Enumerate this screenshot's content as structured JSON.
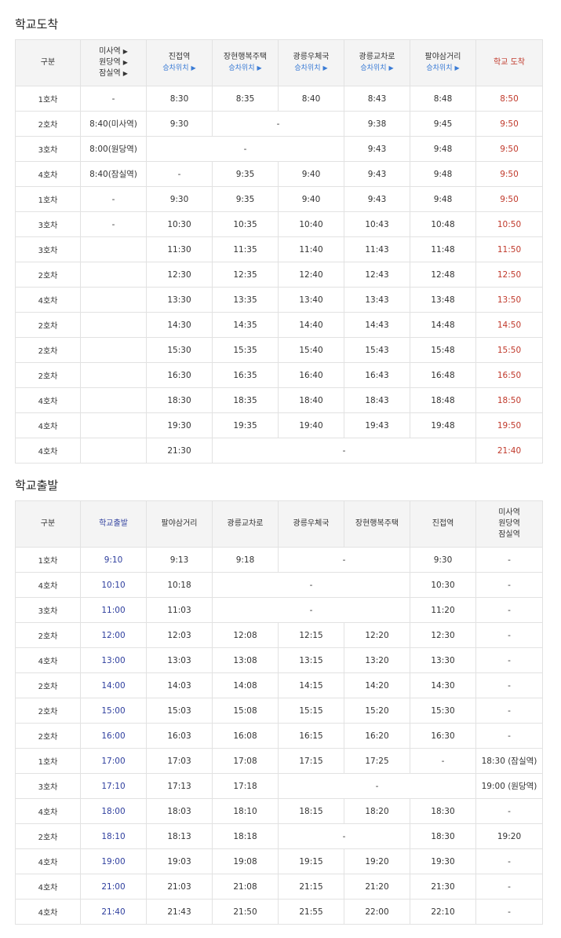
{
  "arrival": {
    "title": "학교도착",
    "headers": {
      "gubun": "구분",
      "origins": [
        "미사역",
        "원당역",
        "잠실역"
      ],
      "jinjeop": "진접역",
      "janghyeon": "장현행복주택",
      "post": "광릉우체국",
      "intersection": "광릉교차로",
      "palya": "팔야삼거리",
      "school": "학교 도착",
      "seat": "승차위치"
    },
    "rows": [
      {
        "car": "1호차",
        "origin": "-",
        "jinjeop": "8:30",
        "janghyeon": "8:35",
        "post": "8:40",
        "inter": "8:43",
        "palya": "8:48",
        "school": "8:50"
      },
      {
        "car": "2호차",
        "origin": "8:40(미사역)",
        "jinjeop": "9:30",
        "merged": "-",
        "inter": "9:38",
        "palya": "9:45",
        "school": "9:50"
      },
      {
        "car": "3호차",
        "origin": "8:00(원당역)",
        "merged3": "-",
        "inter": "9:43",
        "palya": "9:48",
        "school": "9:50"
      },
      {
        "car": "4호차",
        "origin": "8:40(잠실역)",
        "jinjeop": "-",
        "janghyeon": "9:35",
        "post": "9:40",
        "inter": "9:43",
        "palya": "9:48",
        "school": "9:50"
      },
      {
        "car": "1호차",
        "origin": "-",
        "jinjeop": "9:30",
        "janghyeon": "9:35",
        "post": "9:40",
        "inter": "9:43",
        "palya": "9:48",
        "school": "9:50"
      },
      {
        "car": "3호차",
        "origin": "-",
        "jinjeop": "10:30",
        "janghyeon": "10:35",
        "post": "10:40",
        "inter": "10:43",
        "palya": "10:48",
        "school": "10:50"
      },
      {
        "car": "3호차",
        "origin": "",
        "jinjeop": "11:30",
        "janghyeon": "11:35",
        "post": "11:40",
        "inter": "11:43",
        "palya": "11:48",
        "school": "11:50"
      },
      {
        "car": "2호차",
        "origin": "",
        "jinjeop": "12:30",
        "janghyeon": "12:35",
        "post": "12:40",
        "inter": "12:43",
        "palya": "12:48",
        "school": "12:50"
      },
      {
        "car": "4호차",
        "origin": "",
        "jinjeop": "13:30",
        "janghyeon": "13:35",
        "post": "13:40",
        "inter": "13:43",
        "palya": "13:48",
        "school": "13:50"
      },
      {
        "car": "2호차",
        "origin": "",
        "jinjeop": "14:30",
        "janghyeon": "14:35",
        "post": "14:40",
        "inter": "14:43",
        "palya": "14:48",
        "school": "14:50"
      },
      {
        "car": "2호차",
        "origin": "",
        "jinjeop": "15:30",
        "janghyeon": "15:35",
        "post": "15:40",
        "inter": "15:43",
        "palya": "15:48",
        "school": "15:50"
      },
      {
        "car": "2호차",
        "origin": "",
        "jinjeop": "16:30",
        "janghyeon": "16:35",
        "post": "16:40",
        "inter": "16:43",
        "palya": "16:48",
        "school": "16:50"
      },
      {
        "car": "4호차",
        "origin": "",
        "jinjeop": "18:30",
        "janghyeon": "18:35",
        "post": "18:40",
        "inter": "18:43",
        "palya": "18:48",
        "school": "18:50"
      },
      {
        "car": "4호차",
        "origin": "",
        "jinjeop": "19:30",
        "janghyeon": "19:35",
        "post": "19:40",
        "inter": "19:43",
        "palya": "19:48",
        "school": "19:50"
      },
      {
        "car": "4호차",
        "origin": "",
        "jinjeop": "21:30",
        "merged4": "-",
        "school": "21:40"
      }
    ]
  },
  "departure": {
    "title": "학교출발",
    "headers": {
      "gubun": "구분",
      "school": "학교출발",
      "palya": "팔야삼거리",
      "intersection": "광릉교차로",
      "post": "광릉우체국",
      "janghyeon": "장현행복주택",
      "jinjeop": "진접역",
      "dest": [
        "미사역",
        "원당역",
        "잠실역"
      ]
    },
    "rows": [
      {
        "car": "1호차",
        "school": "9:10",
        "palya": "9:13",
        "inter": "9:18",
        "merged2": "-",
        "jinjeop": "9:30",
        "dest": "-"
      },
      {
        "car": "4호차",
        "school": "10:10",
        "palya": "10:18",
        "merged3": "-",
        "jinjeop": "10:30",
        "dest": "-"
      },
      {
        "car": "3호차",
        "school": "11:00",
        "palya": "11:03",
        "merged3": "-",
        "jinjeop": "11:20",
        "dest": "-"
      },
      {
        "car": "2호차",
        "school": "12:00",
        "palya": "12:03",
        "inter": "12:08",
        "post": "12:15",
        "janghyeon": "12:20",
        "jinjeop": "12:30",
        "dest": "-"
      },
      {
        "car": "4호차",
        "school": "13:00",
        "palya": "13:03",
        "inter": "13:08",
        "post": "13:15",
        "janghyeon": "13:20",
        "jinjeop": "13:30",
        "dest": "-"
      },
      {
        "car": "2호차",
        "school": "14:00",
        "palya": "14:03",
        "inter": "14:08",
        "post": "14:15",
        "janghyeon": "14:20",
        "jinjeop": "14:30",
        "dest": "-"
      },
      {
        "car": "2호차",
        "school": "15:00",
        "palya": "15:03",
        "inter": "15:08",
        "post": "15:15",
        "janghyeon": "15:20",
        "jinjeop": "15:30",
        "dest": "-"
      },
      {
        "car": "2호차",
        "school": "16:00",
        "palya": "16:03",
        "inter": "16:08",
        "post": "16:15",
        "janghyeon": "16:20",
        "jinjeop": "16:30",
        "dest": "-"
      },
      {
        "car": "1호차",
        "school": "17:00",
        "palya": "17:03",
        "inter": "17:08",
        "post": "17:15",
        "janghyeon": "17:25",
        "jinjeop": "-",
        "dest": "18:30 (잠실역)"
      },
      {
        "car": "3호차",
        "school": "17:10",
        "palya": "17:13",
        "inter": "17:18",
        "merged3b": "-",
        "dest": "19:00 (원당역)"
      },
      {
        "car": "4호차",
        "school": "18:00",
        "palya": "18:03",
        "inter": "18:10",
        "post": "18:15",
        "janghyeon": "18:20",
        "jinjeop": "18:30",
        "dest": "-"
      },
      {
        "car": "2호차",
        "school": "18:10",
        "palya": "18:13",
        "inter": "18:18",
        "merged2": "-",
        "jinjeop": "18:30",
        "dest": "19:20"
      },
      {
        "car": "4호차",
        "school": "19:00",
        "palya": "19:03",
        "inter": "19:08",
        "post": "19:15",
        "janghyeon": "19:20",
        "jinjeop": "19:30",
        "dest": "-"
      },
      {
        "car": "4호차",
        "school": "21:00",
        "palya": "21:03",
        "inter": "21:08",
        "post": "21:15",
        "janghyeon": "21:20",
        "jinjeop": "21:30",
        "dest": "-"
      },
      {
        "car": "4호차",
        "school": "21:40",
        "palya": "21:43",
        "inter": "21:50",
        "post": "21:55",
        "janghyeon": "22:00",
        "jinjeop": "22:10",
        "dest": "-"
      }
    ]
  }
}
